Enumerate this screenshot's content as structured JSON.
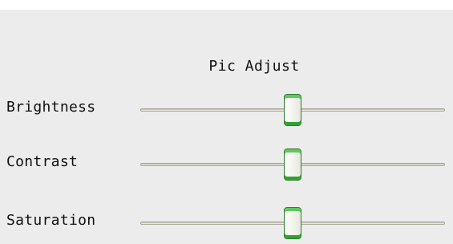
{
  "panel": {
    "title": "Pic Adjust"
  },
  "sliders": [
    {
      "label": "Brightness",
      "value": 0.5
    },
    {
      "label": "Contrast",
      "value": 0.5
    },
    {
      "label": "Saturation",
      "value": 0.5
    }
  ]
}
